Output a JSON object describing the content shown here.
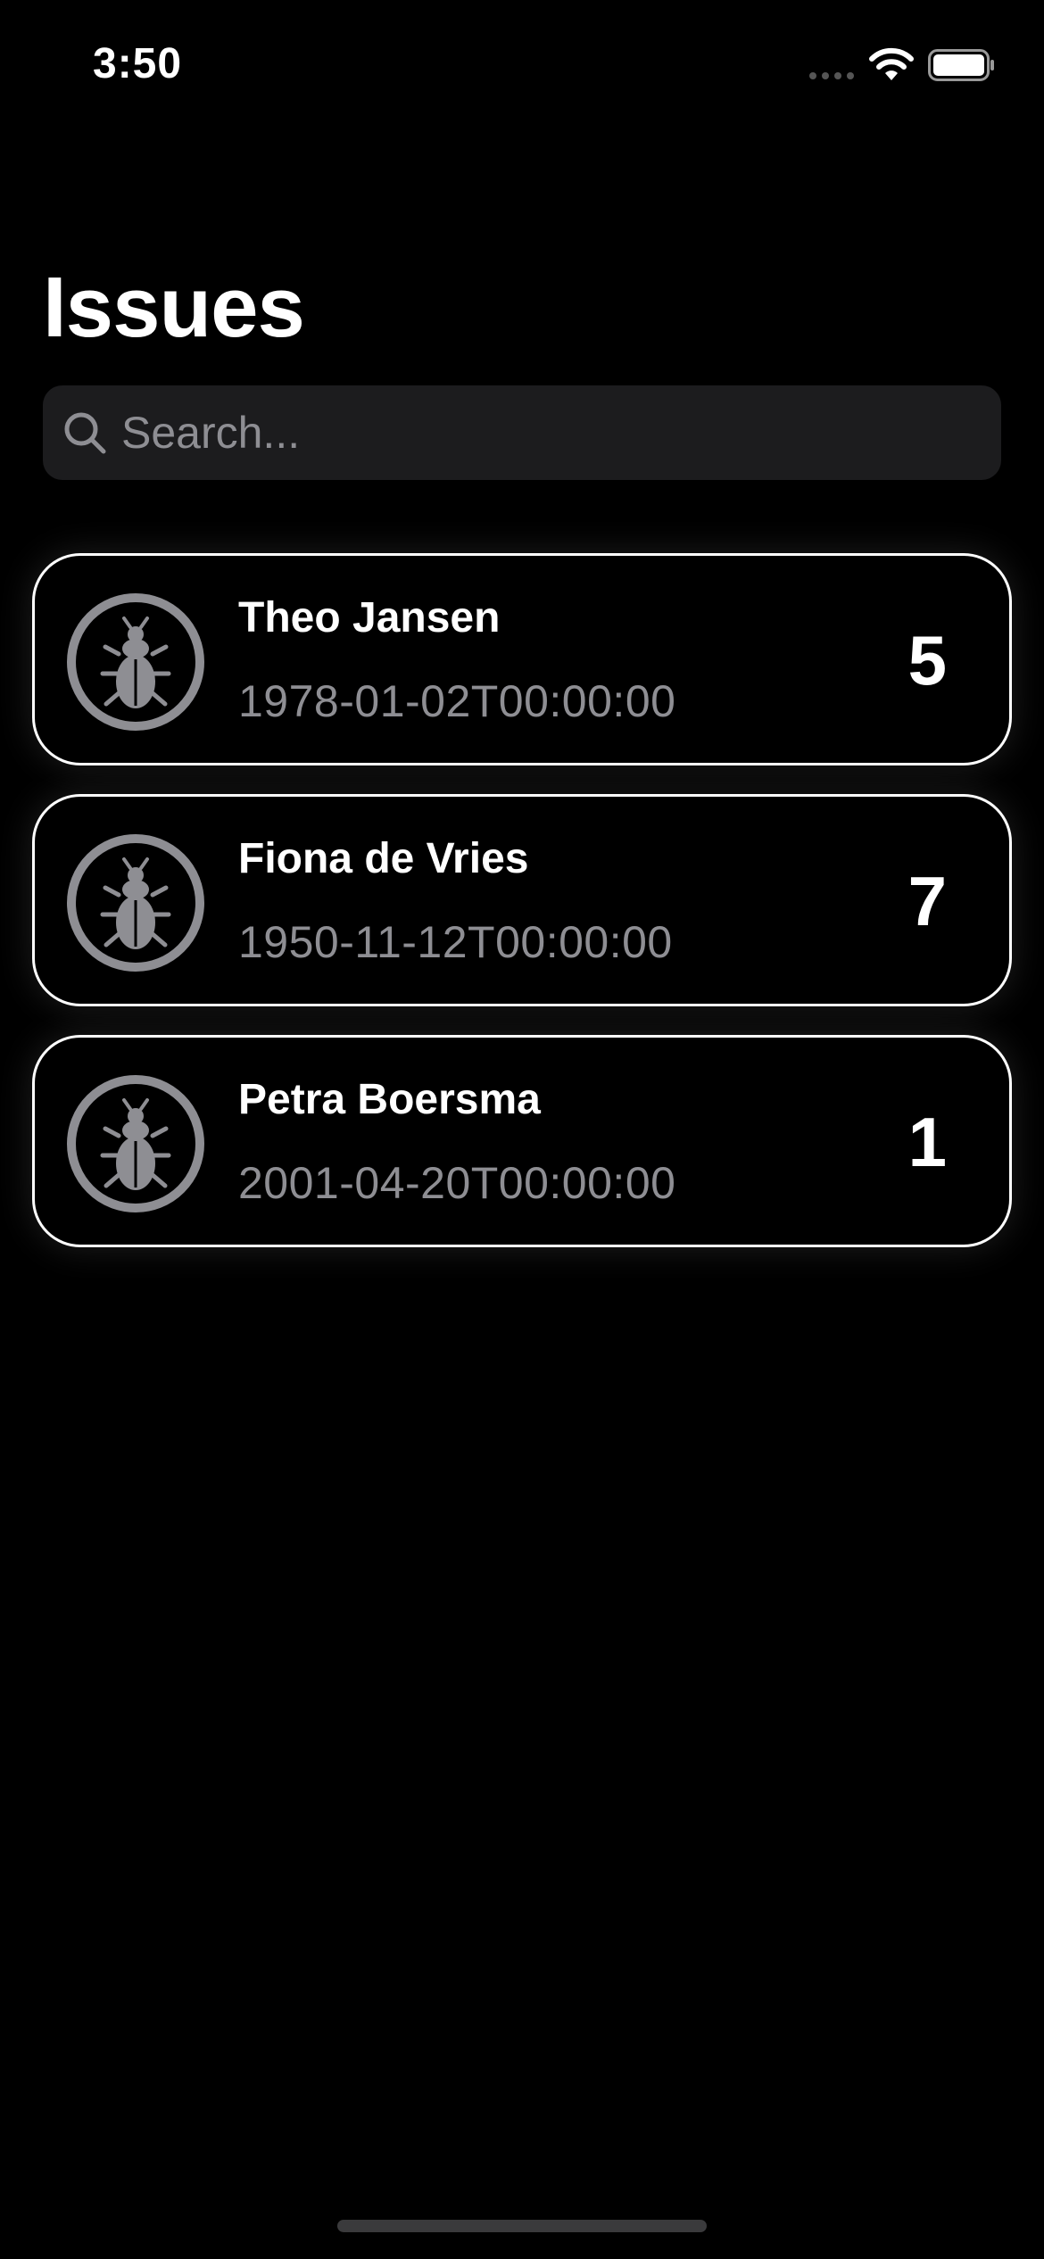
{
  "status_bar": {
    "time": "3:50",
    "icons": [
      "cellular-dots-icon",
      "wifi-icon",
      "battery-icon"
    ]
  },
  "page": {
    "title": "Issues"
  },
  "search": {
    "placeholder": "Search...",
    "value": "",
    "icon": "search-icon"
  },
  "issues": [
    {
      "name": "Theo Jansen",
      "date": "1978-01-02T00:00:00",
      "count": "5",
      "icon": "bug-icon"
    },
    {
      "name": "Fiona de Vries",
      "date": "1950-11-12T00:00:00",
      "count": "7",
      "icon": "bug-icon"
    },
    {
      "name": "Petra Boersma",
      "date": "2001-04-20T00:00:00",
      "count": "1",
      "icon": "bug-icon"
    }
  ],
  "colors": {
    "background": "#000000",
    "search_field": "#1c1c1e",
    "secondary_text": "#8e8e93",
    "card_border": "#ffffff",
    "icon_gray": "#8e8e93"
  }
}
